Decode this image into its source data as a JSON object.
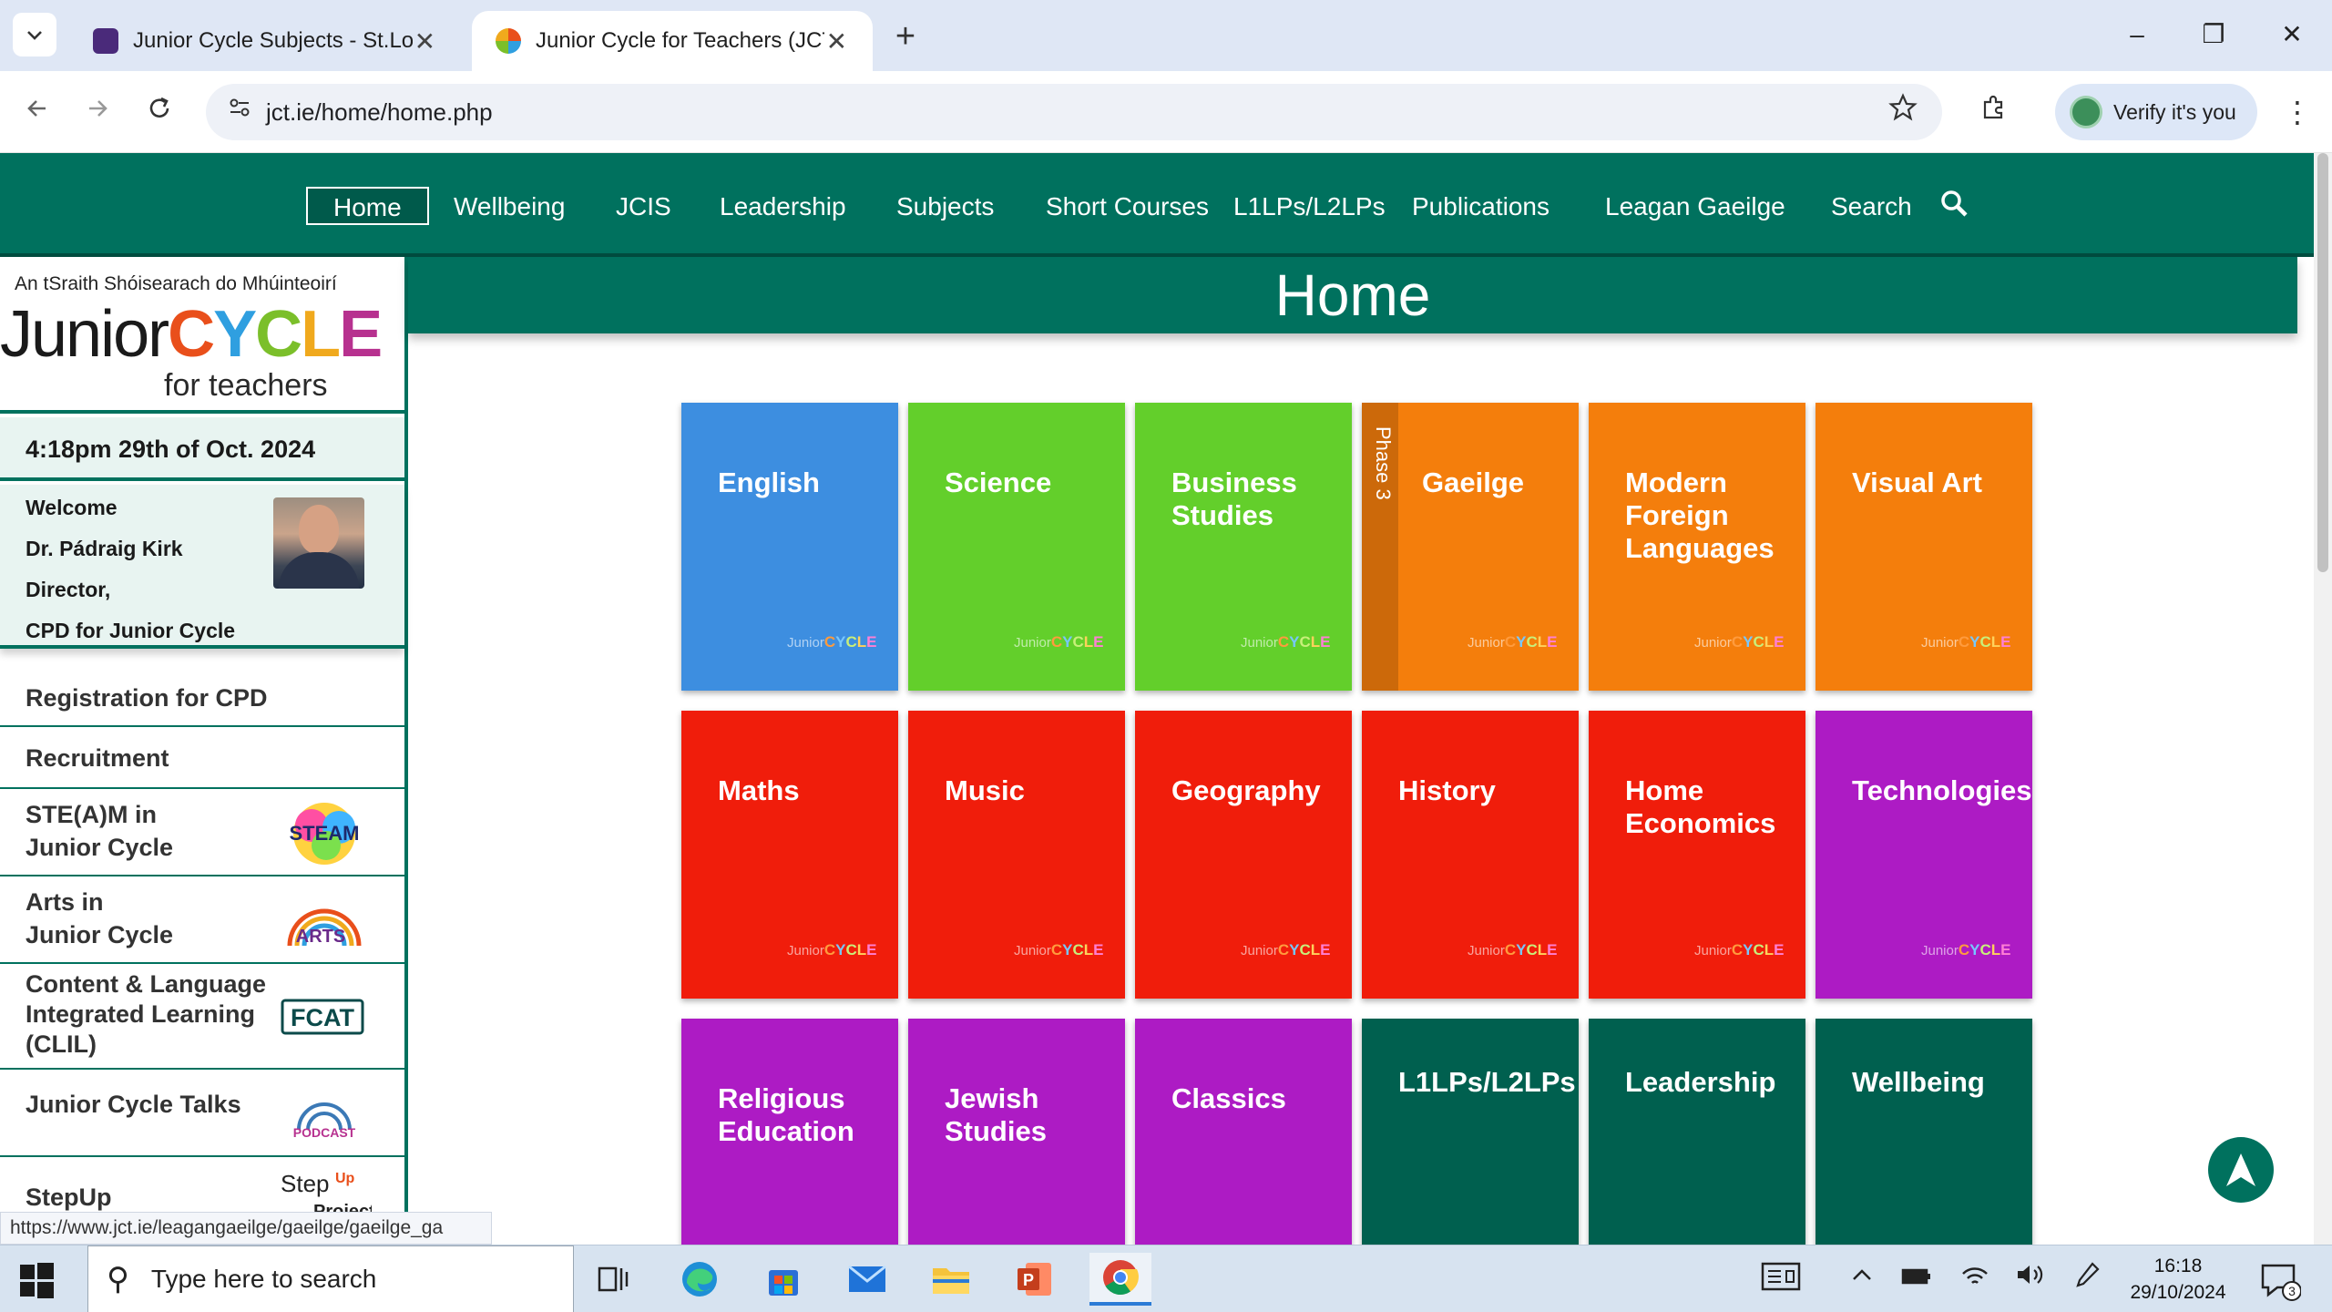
{
  "browser": {
    "tabs": [
      {
        "title": "Junior Cycle Subjects - St.Louis",
        "active": false,
        "close": "✕"
      },
      {
        "title": "Junior Cycle for Teachers (JCT) |",
        "active": true,
        "close": "✕"
      }
    ],
    "new_tab": "+",
    "url": "jct.ie/home/home.php",
    "profile_label": "Verify it's you",
    "window_controls": [
      "–",
      "❐",
      "✕"
    ]
  },
  "nav": {
    "items": [
      "Home",
      "Wellbeing",
      "JCIS",
      "Leadership",
      "Subjects",
      "Short Courses",
      "L1LPs/L2LPs",
      "Publications",
      "Leagan Gaeilge",
      "Search"
    ],
    "active": "Home"
  },
  "sidebar": {
    "logo_small": "An tSraith Shóisearach do Mhúinteoirí",
    "logo_word_plain": "Junior",
    "logo_word_letters": [
      "C",
      "Y",
      "C",
      "L",
      "E"
    ],
    "logo_sub": "for teachers",
    "datetime": "4:18pm  29th of Oct. 2024",
    "welcome": {
      "line1": "Welcome",
      "line2": "Dr. Pádraig Kirk",
      "line3": "Director,",
      "line4": "CPD for Junior Cycle"
    },
    "links": [
      {
        "lines": [
          "Registration for CPD"
        ]
      },
      {
        "lines": [
          "Recruitment"
        ]
      },
      {
        "lines": [
          "STE(A)M in",
          "Junior Cycle"
        ],
        "badge": "STEAM"
      },
      {
        "lines": [
          "Arts in",
          "Junior Cycle"
        ],
        "badge": "ARTS"
      },
      {
        "lines": [
          "Content & Language",
          "Integrated Learning",
          "(CLIL)"
        ],
        "badge": "FCAT"
      },
      {
        "lines": [
          "Junior Cycle Talks"
        ],
        "badge": "PODCAST"
      },
      {
        "lines": [
          "StepUp"
        ],
        "badge_lines": [
          "Step",
          "Up",
          "Project"
        ]
      }
    ]
  },
  "main": {
    "title": "Home",
    "tiles": [
      {
        "label": "English",
        "color": "#3d8ee0"
      },
      {
        "label": "Science",
        "color": "#63cf2b"
      },
      {
        "label": "Business Studies",
        "color": "#63cf2b"
      },
      {
        "label": "Gaeilge",
        "color": "#f47e0c",
        "phase": "Phase 3"
      },
      {
        "label": "Modern Foreign Languages",
        "color": "#f47e0c"
      },
      {
        "label": "Visual Art",
        "color": "#f47e0c"
      },
      {
        "label": "Maths",
        "color": "#f01d0b"
      },
      {
        "label": "Music",
        "color": "#f01d0b"
      },
      {
        "label": "Geography",
        "color": "#f01d0b"
      },
      {
        "label": "History",
        "color": "#f01d0b"
      },
      {
        "label": "Home Economics",
        "color": "#f01d0b"
      },
      {
        "label": "Technologies",
        "color": "#ad1bc4"
      },
      {
        "label": "Religious Education",
        "color": "#ad1bc4"
      },
      {
        "label": "Jewish Studies",
        "color": "#ad1bc4"
      },
      {
        "label": "Classics",
        "color": "#ad1bc4"
      },
      {
        "label": "L1LPs/L2LPs",
        "color": "#00604f"
      },
      {
        "label": "Leadership",
        "color": "#00604f"
      },
      {
        "label": "Wellbeing",
        "color": "#00604f"
      }
    ],
    "tile_mini_logo": {
      "plain": "Junior",
      "letters": [
        "C",
        "Y",
        "C",
        "L",
        "E"
      ]
    }
  },
  "status_bar_url": "https://www.jct.ie/leagangaeilge/gaeilge/gaeilge_ga",
  "taskbar": {
    "search_placeholder": "Type here to search",
    "time": "16:18",
    "date": "29/10/2024",
    "notification_count": "3"
  },
  "colors": {
    "brand_green": "#00715e",
    "brand_dark_green": "#00604f",
    "tab_bar": "#dfe7f5"
  }
}
